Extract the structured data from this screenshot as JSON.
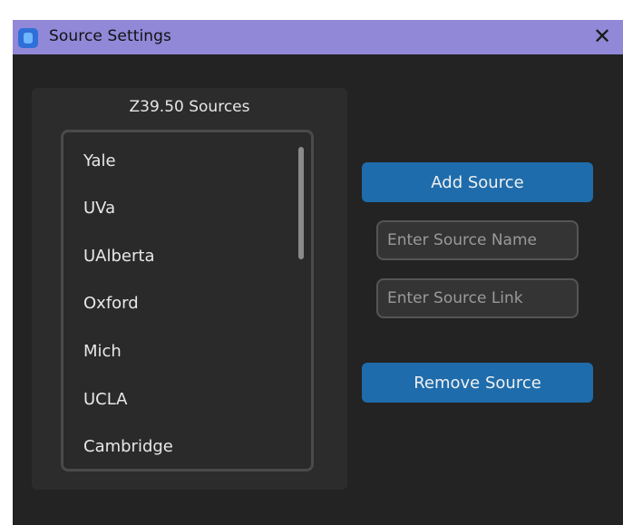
{
  "window": {
    "title": "Source Settings",
    "app_icon": "app-window-icon",
    "close_symbol": "✕"
  },
  "sources_panel": {
    "title": "Z39.50 Sources",
    "items": [
      {
        "label": "Yale"
      },
      {
        "label": "UVa"
      },
      {
        "label": "UAlberta"
      },
      {
        "label": "Oxford"
      },
      {
        "label": "Mich"
      },
      {
        "label": "UCLA"
      },
      {
        "label": "Cambridge"
      }
    ]
  },
  "actions": {
    "add_label": "Add Source",
    "remove_label": "Remove Source",
    "name_placeholder": "Enter Source Name",
    "link_placeholder": "Enter Source Link"
  },
  "colors": {
    "titlebar": "#9188d8",
    "window_bg": "#232323",
    "panel_bg": "#2c2c2c",
    "button": "#1e6cab"
  }
}
